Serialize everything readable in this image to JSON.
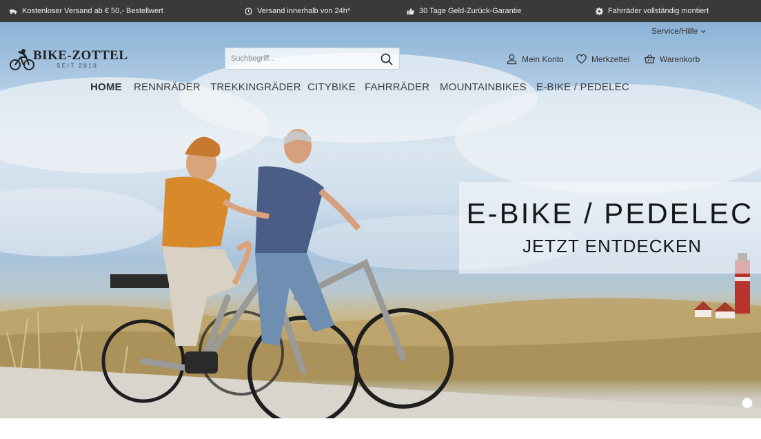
{
  "topbar": {
    "usps": [
      {
        "icon": "truck-icon",
        "text": "Kostenloser Versand ab € 50,- Bestellwert"
      },
      {
        "icon": "clock-icon",
        "text": "Versand innerhalb von 24h*"
      },
      {
        "icon": "thumbs-up-icon",
        "text": "30 Tage Geld-Zurück-Garantie"
      },
      {
        "icon": "gear-icon",
        "text": "Fahrräder vollständig montiert"
      }
    ]
  },
  "header": {
    "service_label": "Service/Hilfe",
    "logo": {
      "name": "BIKE-ZOTTEL",
      "tagline": "SEIT 2010"
    },
    "search": {
      "placeholder": "Suchbegriff..."
    },
    "account": {
      "my_account": "Mein Konto",
      "wishlist": "Merkzettel",
      "cart": "Warenkorb"
    }
  },
  "nav": {
    "items": [
      {
        "label": "HOME",
        "active": true
      },
      {
        "label": "RENNRÄDER",
        "active": false
      },
      {
        "label": "TREKKINGRÄDER",
        "active": false
      },
      {
        "label": "CITYBIKE",
        "active": false
      },
      {
        "label": "FAHRRÄDER",
        "active": false
      },
      {
        "label": "MOUNTAINBIKES",
        "active": false
      },
      {
        "label": "E-BIKE / PEDELEC",
        "active": false
      }
    ]
  },
  "hero": {
    "title": "E-BIKE / PEDELEC",
    "subtitle": "JETZT ENTDECKEN",
    "slide_count": 1,
    "active_slide": 1
  },
  "colors": {
    "topbar_bg": "#3a3a3a",
    "nav_text": "#3c3f44",
    "promo_text": "#15171a"
  }
}
